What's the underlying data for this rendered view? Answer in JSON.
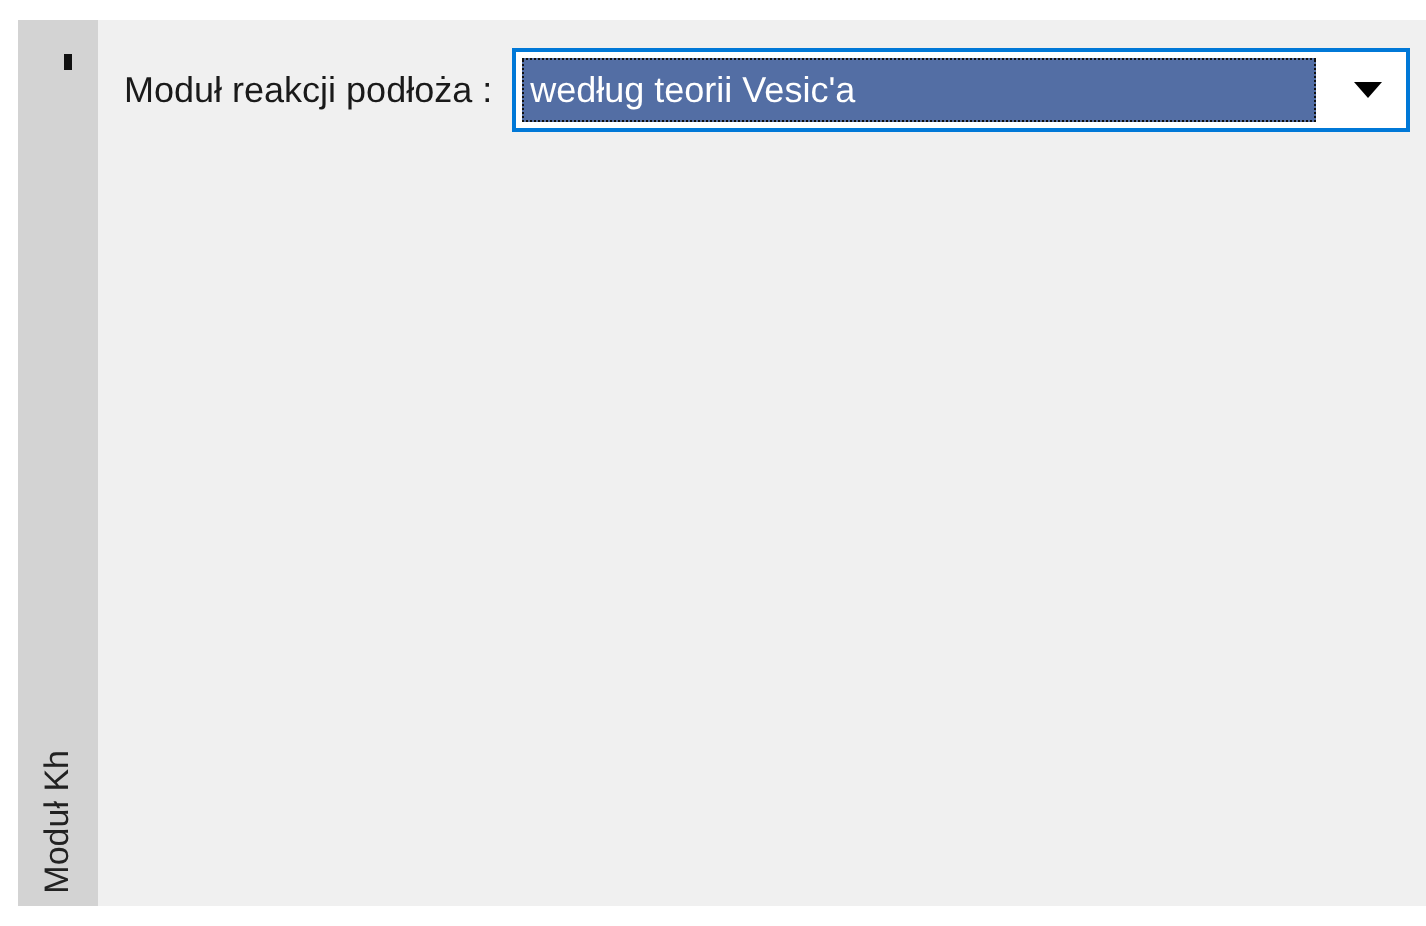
{
  "side_tab": {
    "label": "Moduł Kh"
  },
  "form": {
    "label": "Moduł reakcji podłoża :",
    "dropdown": {
      "value": "według teorii Vesic'a",
      "focused": true
    }
  }
}
